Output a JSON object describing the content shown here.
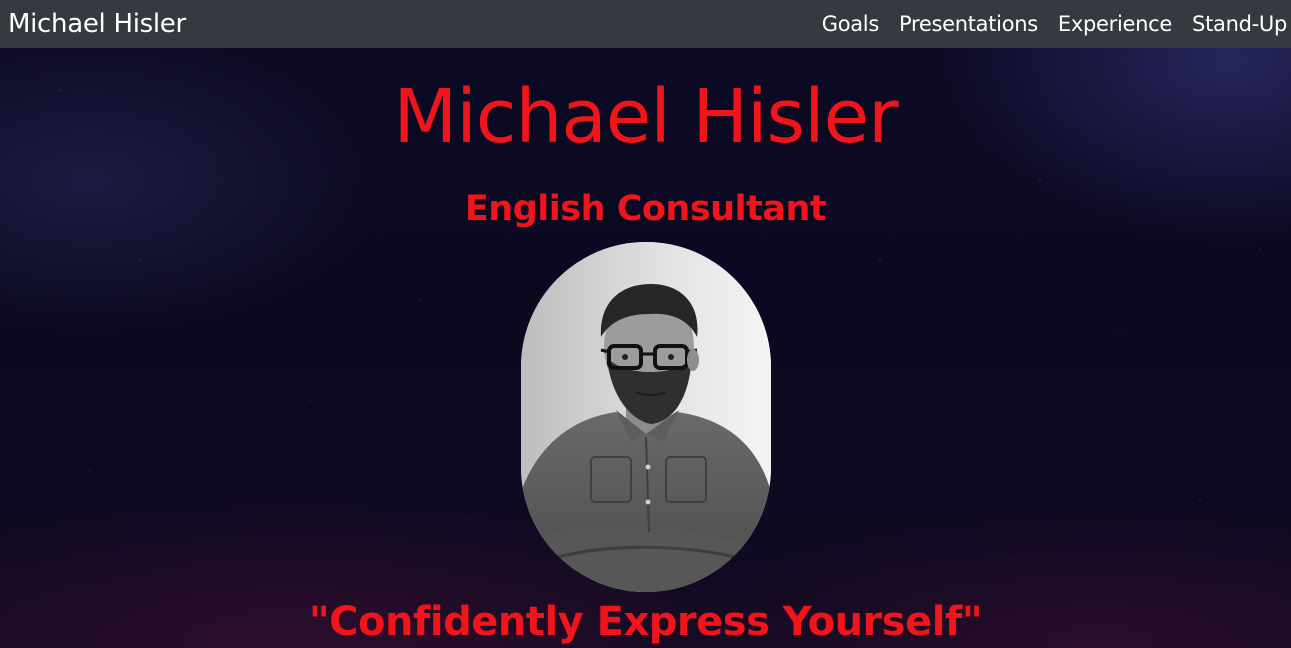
{
  "navbar": {
    "brand": "Michael Hisler",
    "links": [
      {
        "label": "Goals"
      },
      {
        "label": "Presentations"
      },
      {
        "label": "Experience"
      },
      {
        "label": "Stand-Up"
      }
    ]
  },
  "hero": {
    "title": "Michael Hisler",
    "subtitle": "English Consultant",
    "quote": "\"Confidently Express Yourself\"",
    "photo_alt": "Michael Hisler"
  },
  "colors": {
    "accent": "#f0141b",
    "navbar_bg": "#343a40",
    "page_bg": "#0b0920"
  }
}
